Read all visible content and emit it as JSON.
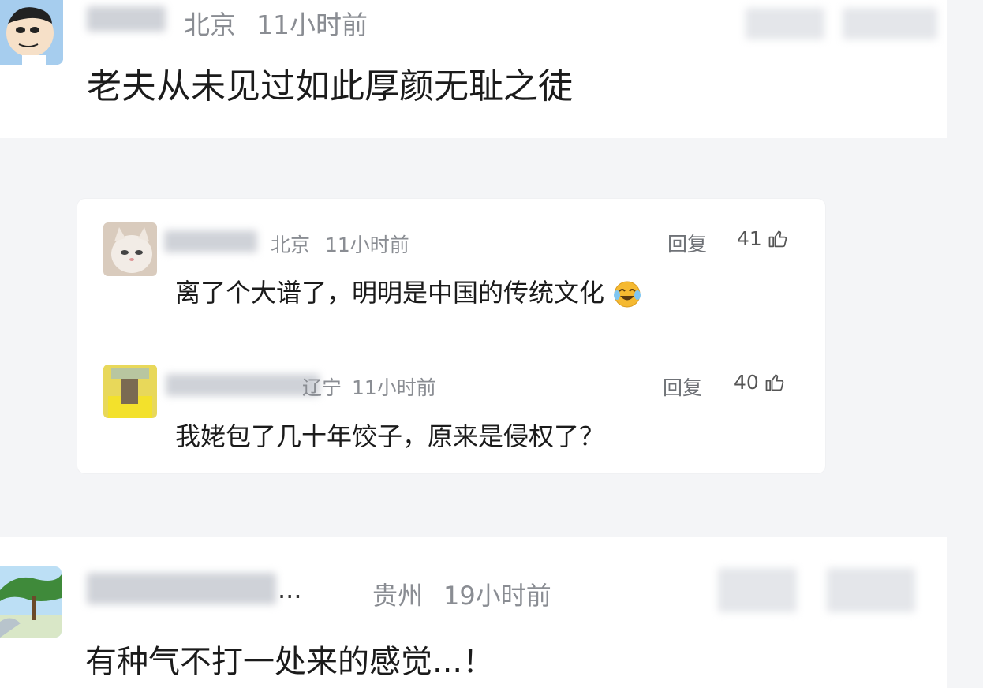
{
  "comments": [
    {
      "location": "北京",
      "time": "11小时前",
      "text": "老夫从未见过如此厚颜无耻之徒",
      "replies": [
        {
          "location": "北京",
          "time": "11小时前",
          "text": "离了个大谱了，明明是中国的传统文化",
          "emoji_icon": "laugh-cry-emoji-icon",
          "reply_label": "回复",
          "likes": "41"
        },
        {
          "location": "辽宁",
          "time": "11小时前",
          "text": "我姥包了几十年饺子，原来是侵权了？",
          "reply_label": "回复",
          "likes": "40"
        }
      ]
    },
    {
      "username_suffix": "...",
      "location": "贵州",
      "time": "19小时前",
      "text": "有种气不打一处来的感觉...！"
    }
  ],
  "icons": {
    "like": "thumbs-up-icon",
    "avatar1": "cartoon-avatar-icon",
    "avatar2": "cat-avatar-icon",
    "avatar3": "yellow-avatar-icon",
    "avatar4": "landscape-avatar-icon"
  },
  "colors": {
    "meta": "#8a8d93",
    "text": "#1b1b1b",
    "background": "#f4f5f7",
    "card": "#ffffff"
  }
}
